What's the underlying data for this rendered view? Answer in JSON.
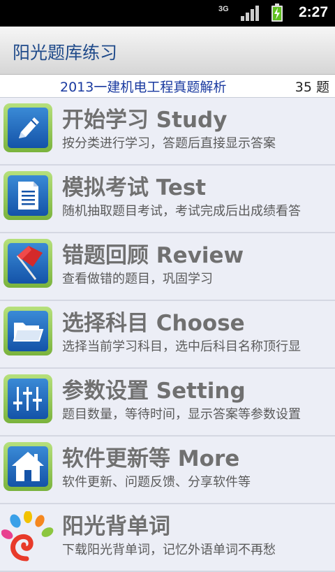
{
  "status_bar": {
    "network": "3G",
    "time": "2:27"
  },
  "app_title": "阳光题库练习",
  "info_bar": {
    "subject": "2013一建机电工程真题解析",
    "count": "35 题"
  },
  "menu": [
    {
      "label": "开始学习 Study",
      "desc": "按分类进行学习，答题后直接显示答案",
      "icon": "pencil-icon"
    },
    {
      "label": "模拟考试 Test",
      "desc": "随机抽取题目考试，考试完成后出成绩看答",
      "icon": "document-icon"
    },
    {
      "label": "错题回顾 Review",
      "desc": "查看做错的题目，巩固学习",
      "icon": "flag-icon"
    },
    {
      "label": "选择科目 Choose",
      "desc": "选择当前学习科目，选中后科目名称顶行显",
      "icon": "folder-icon"
    },
    {
      "label": "参数设置 Setting",
      "desc": "题目数量，等待时间，显示答案等参数设置",
      "icon": "sliders-icon"
    },
    {
      "label": "软件更新等 More",
      "desc": "软件更新、问题反馈、分享软件等",
      "icon": "home-icon"
    },
    {
      "label": "阳光背单词",
      "desc": "下载阳光背单词，记忆外语单词不再愁",
      "icon": "sunshine-logo-icon"
    }
  ]
}
